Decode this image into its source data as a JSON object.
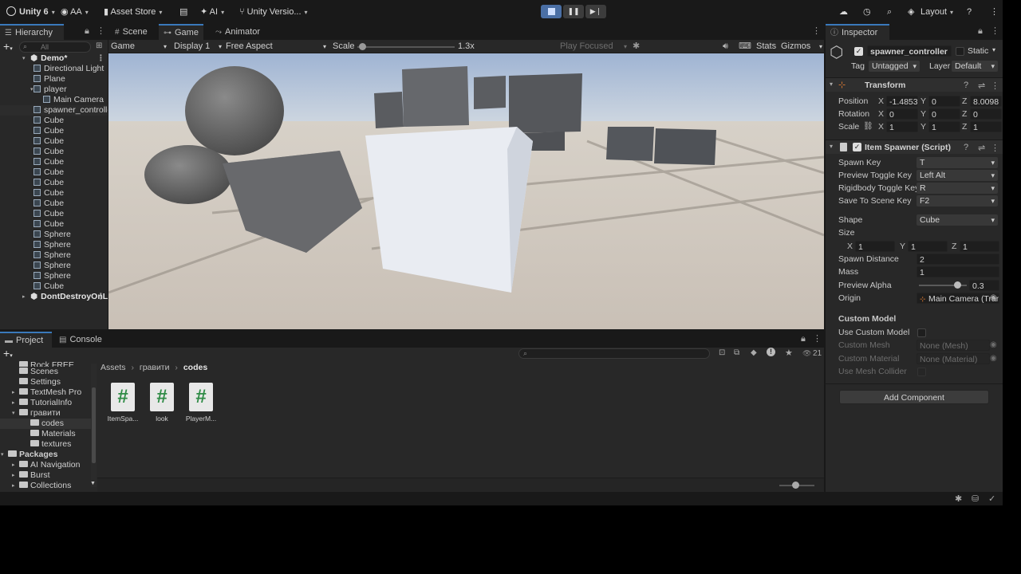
{
  "toolbar": {
    "app": "Unity 6",
    "account": "AA",
    "asset_store": "Asset Store",
    "ai": "AI",
    "version_control": "Unity Versio...",
    "layout": "Layout"
  },
  "hierarchy": {
    "tab": "Hierarchy",
    "search_placeholder": "All",
    "items": [
      {
        "label": "Demo*"
      },
      {
        "label": "Directional Light"
      },
      {
        "label": "Plane"
      },
      {
        "label": "player"
      },
      {
        "label": "Main Camera"
      },
      {
        "label": "spawner_controller"
      },
      {
        "label": "Cube"
      },
      {
        "label": "Cube"
      },
      {
        "label": "Cube"
      },
      {
        "label": "Cube"
      },
      {
        "label": "Cube"
      },
      {
        "label": "Cube"
      },
      {
        "label": "Cube"
      },
      {
        "label": "Cube"
      },
      {
        "label": "Cube"
      },
      {
        "label": "Cube"
      },
      {
        "label": "Cube"
      },
      {
        "label": "Sphere"
      },
      {
        "label": "Sphere"
      },
      {
        "label": "Sphere"
      },
      {
        "label": "Sphere"
      },
      {
        "label": "Sphere"
      },
      {
        "label": "Cube"
      },
      {
        "label": "DontDestroyOnLoad"
      }
    ]
  },
  "view_tabs": {
    "scene": "Scene",
    "game": "Game",
    "animator": "Animator"
  },
  "game_bar": {
    "mode": "Game",
    "display": "Display 1",
    "aspect": "Free Aspect",
    "scale_label": "Scale",
    "scale_value": "1.3x",
    "scale_fraction": 0.05,
    "play_focused": "Play Focused",
    "stats": "Stats",
    "gizmos": "Gizmos"
  },
  "inspector": {
    "tab": "Inspector",
    "object_name": "spawner_controller",
    "static_label": "Static",
    "tag_label": "Tag",
    "tag_value": "Untagged",
    "layer_label": "Layer",
    "layer_value": "Default",
    "transform": {
      "title": "Transform",
      "position_label": "Position",
      "rotation_label": "Rotation",
      "scale_label": "Scale",
      "position": [
        "-1.4853",
        "0",
        "8.0098"
      ],
      "rotation": [
        "0",
        "0",
        "0"
      ],
      "scale": [
        "1",
        "1",
        "1"
      ]
    },
    "spawner": {
      "title": "Item Spawner (Script)",
      "fields": [
        {
          "label": "Spawn Key",
          "value": "T"
        },
        {
          "label": "Preview Toggle Key",
          "value": "Left Alt"
        },
        {
          "label": "Rigidbody Toggle Key",
          "value": "R"
        },
        {
          "label": "Save To Scene Key",
          "value": "F2"
        }
      ],
      "shape_label": "Shape",
      "shape_value": "Cube",
      "size_label": "Size",
      "size": [
        "1",
        "1",
        "1"
      ],
      "spawn_distance_label": "Spawn Distance",
      "spawn_distance": "2",
      "mass_label": "Mass",
      "mass": "1",
      "preview_alpha_label": "Preview Alpha",
      "preview_alpha": "0.3",
      "origin_label": "Origin",
      "origin_value": "Main Camera (Transform)",
      "custom_model_header": "Custom Model",
      "use_custom_model": "Use Custom Model",
      "custom_mesh_label": "Custom Mesh",
      "custom_mesh_value": "None (Mesh)",
      "custom_material_label": "Custom Material",
      "custom_material_value": "None (Material)",
      "use_mesh_collider": "Use Mesh Collider"
    },
    "add_component": "Add Component"
  },
  "project": {
    "tab_project": "Project",
    "tab_console": "Console",
    "breadcrumb": [
      "Assets",
      "гравити",
      "codes"
    ],
    "hidden_count": "21",
    "tree": [
      {
        "label": "Rock FREE"
      },
      {
        "label": "Scenes"
      },
      {
        "label": "Settings"
      },
      {
        "label": "TextMesh Pro"
      },
      {
        "label": "TutorialInfo"
      },
      {
        "label": "гравити"
      },
      {
        "label": "codes"
      },
      {
        "label": "Materials"
      },
      {
        "label": "textures"
      },
      {
        "label": "Packages"
      },
      {
        "label": "AI Navigation"
      },
      {
        "label": "Burst"
      },
      {
        "label": "Collections"
      }
    ],
    "assets": [
      {
        "label": "ItemSpa..."
      },
      {
        "label": "look"
      },
      {
        "label": "PlayerM..."
      }
    ]
  }
}
